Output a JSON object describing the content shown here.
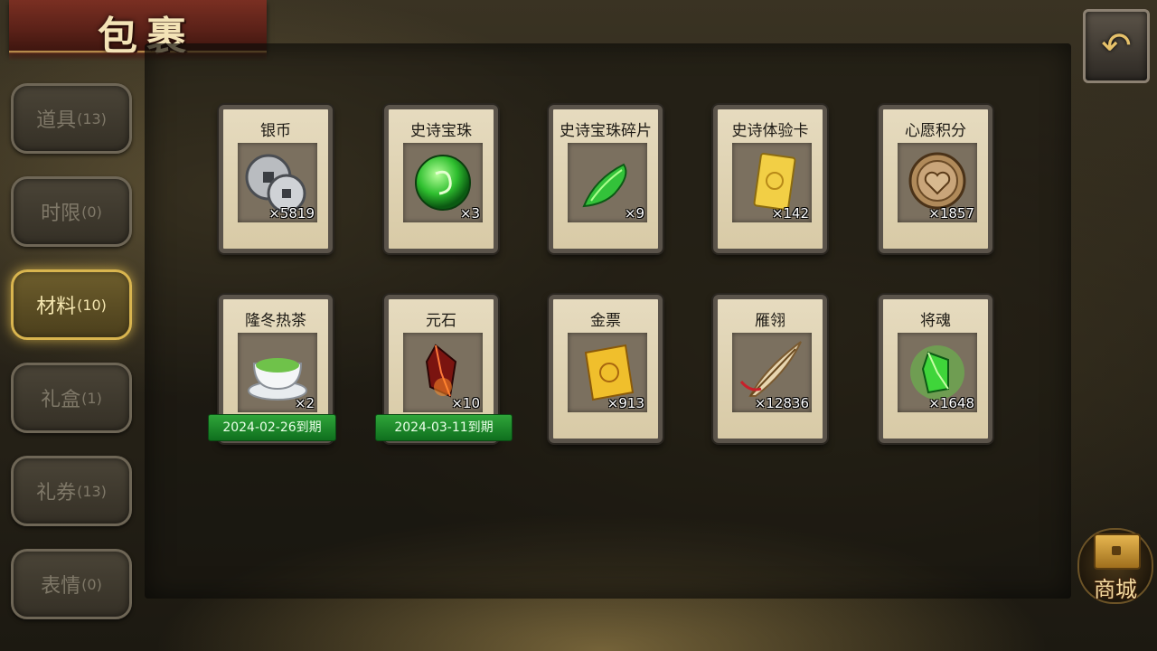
{
  "title": "包裹",
  "back_button": {
    "icon": "back-arrow-icon"
  },
  "tabs": [
    {
      "label": "道具",
      "count": "(13)",
      "active": false
    },
    {
      "label": "时限",
      "count": "(0)",
      "active": false
    },
    {
      "label": "材料",
      "count": "(10)",
      "active": true
    },
    {
      "label": "礼盒",
      "count": "(1)",
      "active": false
    },
    {
      "label": "礼券",
      "count": "(13)",
      "active": false
    },
    {
      "label": "表情",
      "count": "(0)",
      "active": false
    }
  ],
  "items": [
    {
      "name": "银币",
      "qty": "×5819",
      "icon": "silver-coins-icon"
    },
    {
      "name": "史诗宝珠",
      "qty": "×3",
      "icon": "green-orb-icon"
    },
    {
      "name": "史诗宝珠碎片",
      "qty": "×9",
      "icon": "green-shard-icon"
    },
    {
      "name": "史诗体验卡",
      "qty": "×142",
      "icon": "gold-card-icon"
    },
    {
      "name": "心愿积分",
      "qty": "×1857",
      "icon": "heart-coin-icon"
    },
    {
      "name": "隆冬热茶",
      "qty": "×2",
      "icon": "tea-cup-icon",
      "expiry": "2024-02-26到期"
    },
    {
      "name": "元石",
      "qty": "×10",
      "icon": "red-crystal-icon",
      "expiry": "2024-03-11到期"
    },
    {
      "name": "金票",
      "qty": "×913",
      "icon": "gold-scroll-icon"
    },
    {
      "name": "雁翎",
      "qty": "×12836",
      "icon": "feather-icon"
    },
    {
      "name": "将魂",
      "qty": "×1648",
      "icon": "green-soul-crystal-icon"
    }
  ],
  "mall_button": {
    "label": "商城",
    "icon": "treasure-chest-icon"
  },
  "colors": {
    "active_tab_border": "#d9b54f",
    "expiry_green": "#2fa53a",
    "banner_red": "#5a2118"
  }
}
